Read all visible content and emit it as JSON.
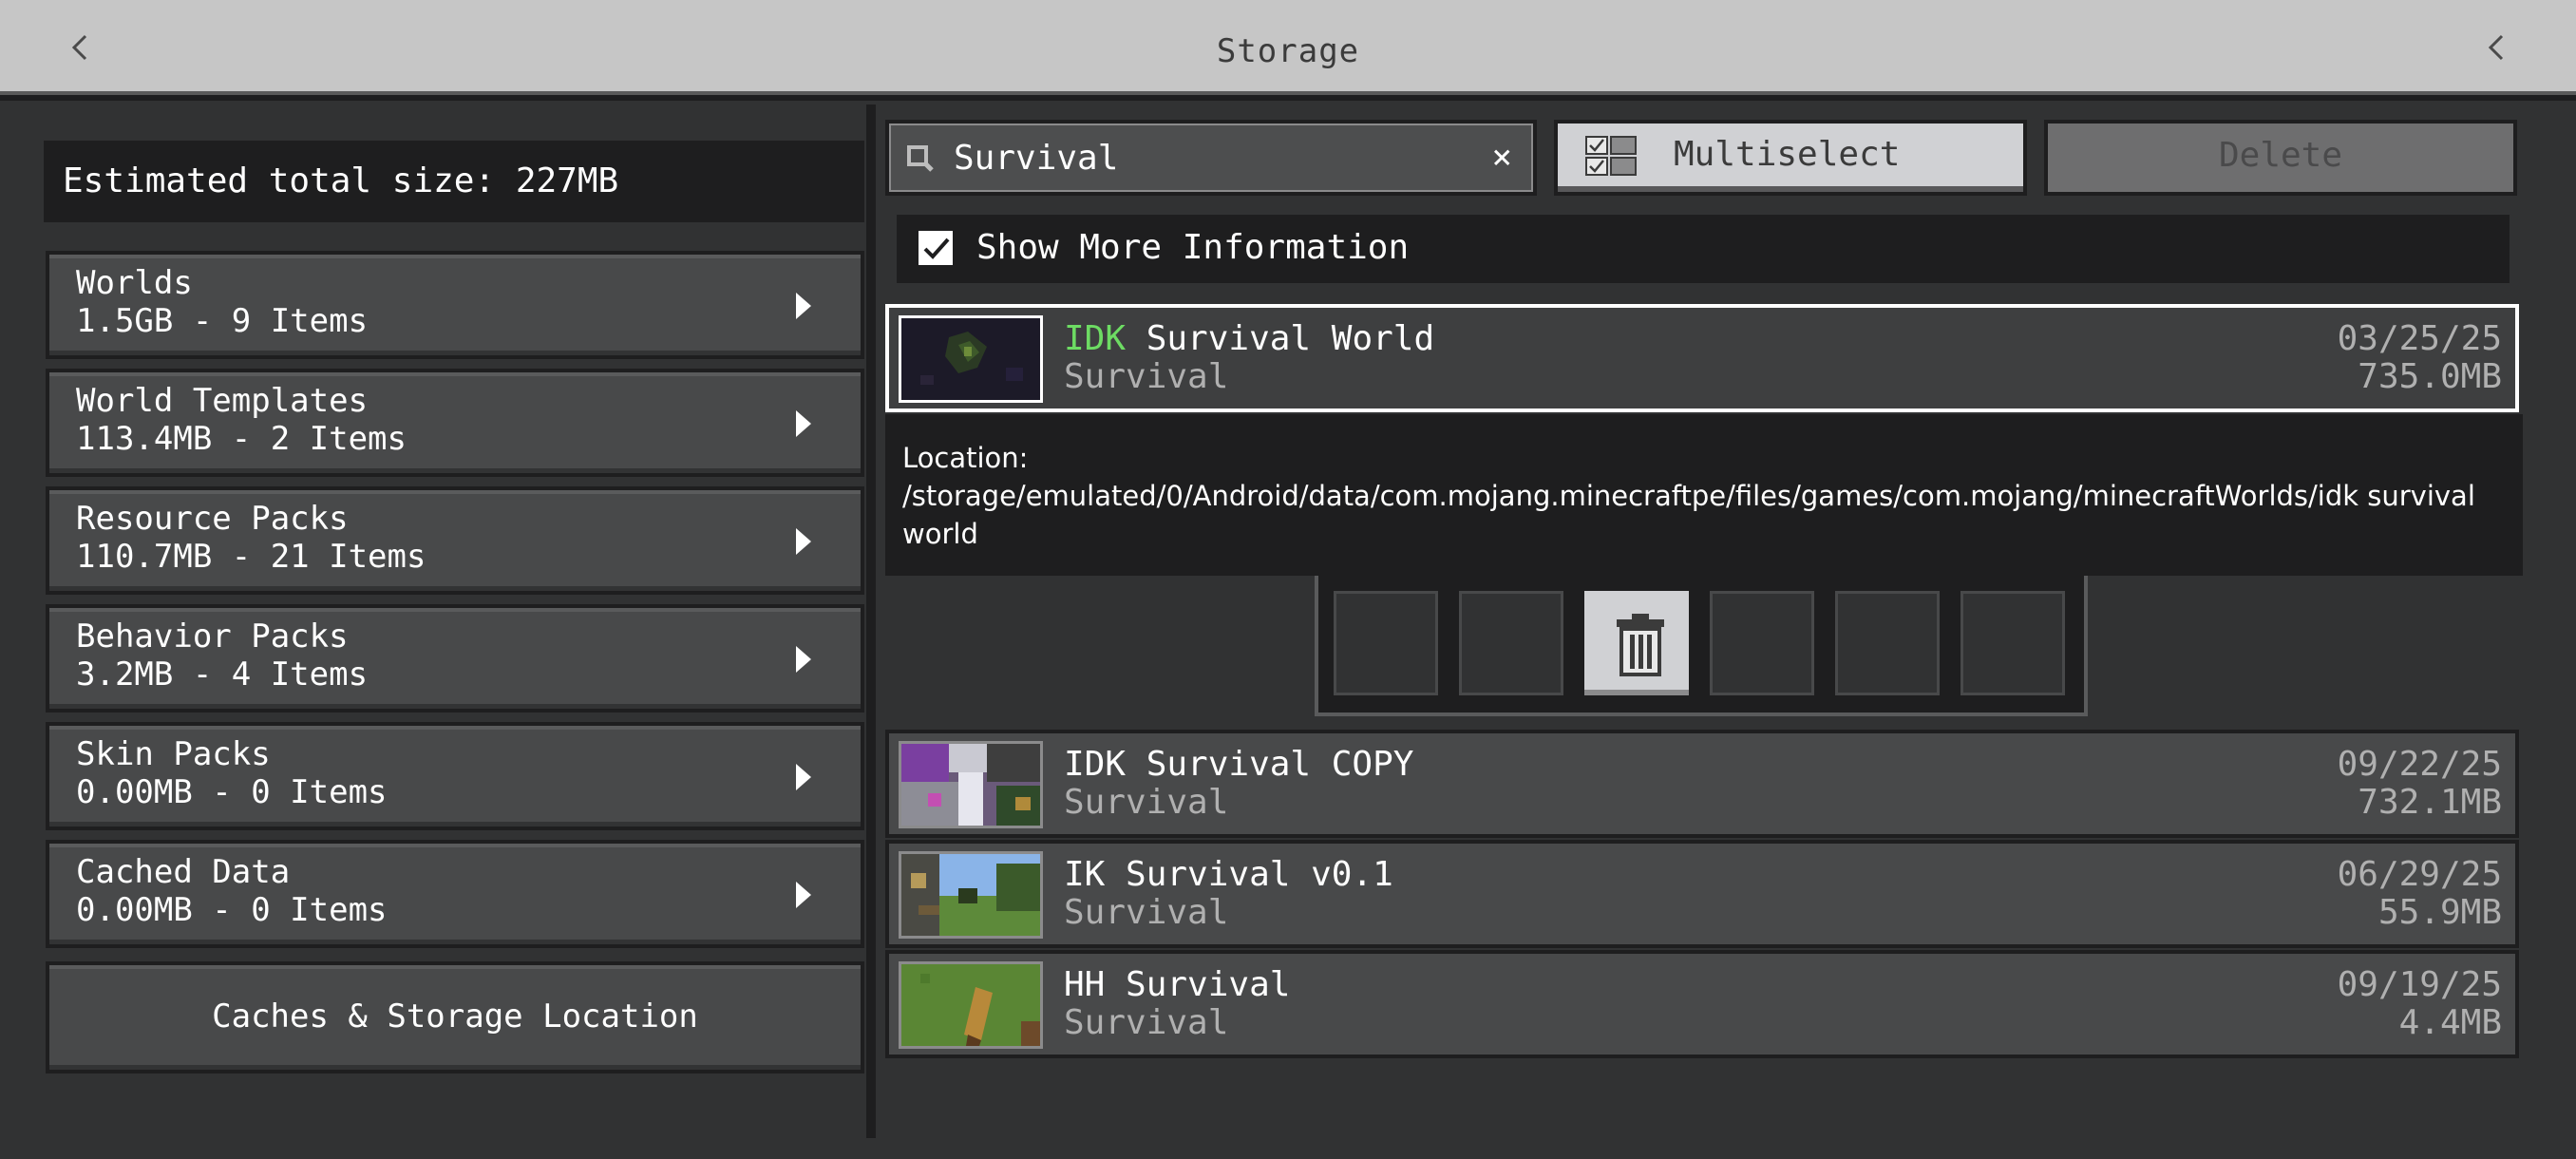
{
  "header": {
    "title": "Storage",
    "back_icon": "chevron-left-icon",
    "collapse_icon": "chevron-left-icon"
  },
  "left": {
    "estimated": "Estimated total size: 227MB",
    "categories": [
      {
        "name": "Worlds",
        "detail": "1.5GB - 9 Items"
      },
      {
        "name": "World Templates",
        "detail": "113.4MB - 2 Items"
      },
      {
        "name": "Resource Packs",
        "detail": "110.7MB - 21 Items"
      },
      {
        "name": "Behavior Packs",
        "detail": "3.2MB - 4 Items"
      },
      {
        "name": "Skin Packs",
        "detail": "0.00MB - 0 Items"
      },
      {
        "name": "Cached Data",
        "detail": "0.00MB - 0 Items"
      }
    ],
    "caches_button": "Caches & Storage Location"
  },
  "toolbar": {
    "search_value": "Survival",
    "clear_glyph": "×",
    "multiselect_label": "Multiselect",
    "delete_label": "Delete"
  },
  "show_info": {
    "label": "Show More Information",
    "checked": true
  },
  "worlds": [
    {
      "name_highlight": "IDK",
      "name_rest": " Survival World",
      "mode": "Survival",
      "date": "03/25/25",
      "size": "735.0MB",
      "selected": true
    },
    {
      "name": "IDK Survival COPY",
      "mode": "Survival",
      "date": "09/22/25",
      "size": "732.1MB"
    },
    {
      "name": "IK Survival v0.1",
      "mode": "Survival",
      "date": "06/29/25",
      "size": "55.9MB"
    },
    {
      "name": "HH Survival",
      "mode": "Survival",
      "date": "09/19/25",
      "size": "4.4MB"
    }
  ],
  "location": {
    "label": "Location:",
    "path": "/storage/emulated/0/Android/data/com.mojang.minecraftpe/files/games/com.mojang/minecraftWorlds/idk survival world"
  },
  "actions": {
    "active_icon": "trash-icon"
  },
  "colors": {
    "highlight": "#6ddc63",
    "header": "#c6c6c6",
    "panel": "#48494a",
    "background": "#313233"
  }
}
